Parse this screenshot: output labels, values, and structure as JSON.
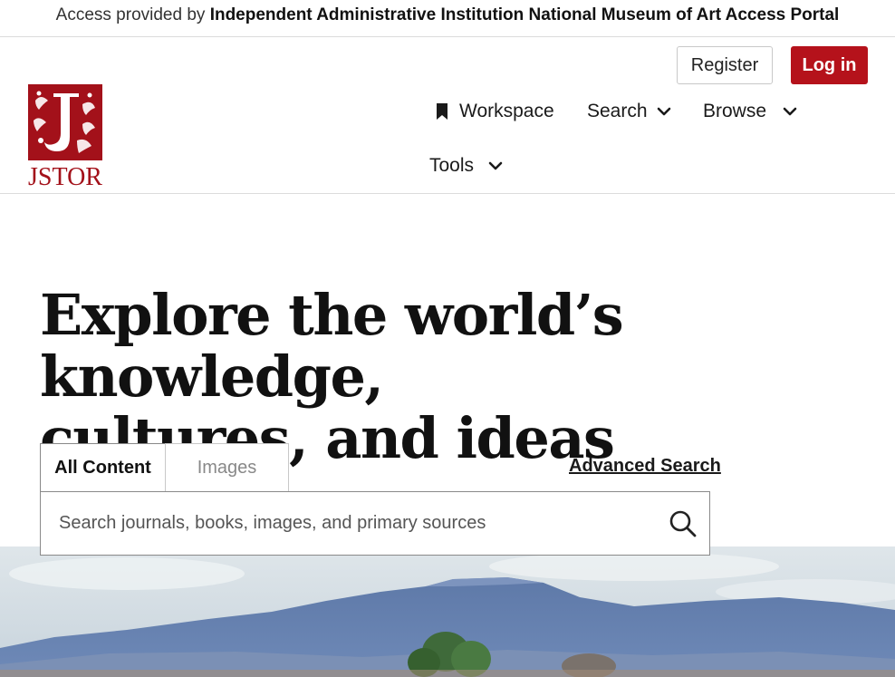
{
  "access_bar": {
    "prefix": "Access provided by",
    "institution": "Independent Administrative Institution National Museum of Art Access Portal"
  },
  "auth": {
    "register_label": "Register",
    "login_label": "Log in"
  },
  "logo": {
    "text": "JSTOR"
  },
  "nav": {
    "workspace": "Workspace",
    "search": "Search",
    "browse": "Browse",
    "tools": "Tools"
  },
  "hero": {
    "title_line1": "Explore the world’s knowledge,",
    "title_line2": "cultures, and ideas"
  },
  "search": {
    "tabs": [
      "All Content",
      "Images"
    ],
    "active_tab": "All Content",
    "advanced_label": "Advanced Search",
    "placeholder": "Search journals, books, images, and primary sources",
    "value": ""
  },
  "colors": {
    "brand_red": "#b5121b",
    "border": "#dcdcdc"
  },
  "icons": {
    "bookmark": "bookmark-icon",
    "chevron": "chevron-down-icon",
    "search": "search-icon"
  }
}
